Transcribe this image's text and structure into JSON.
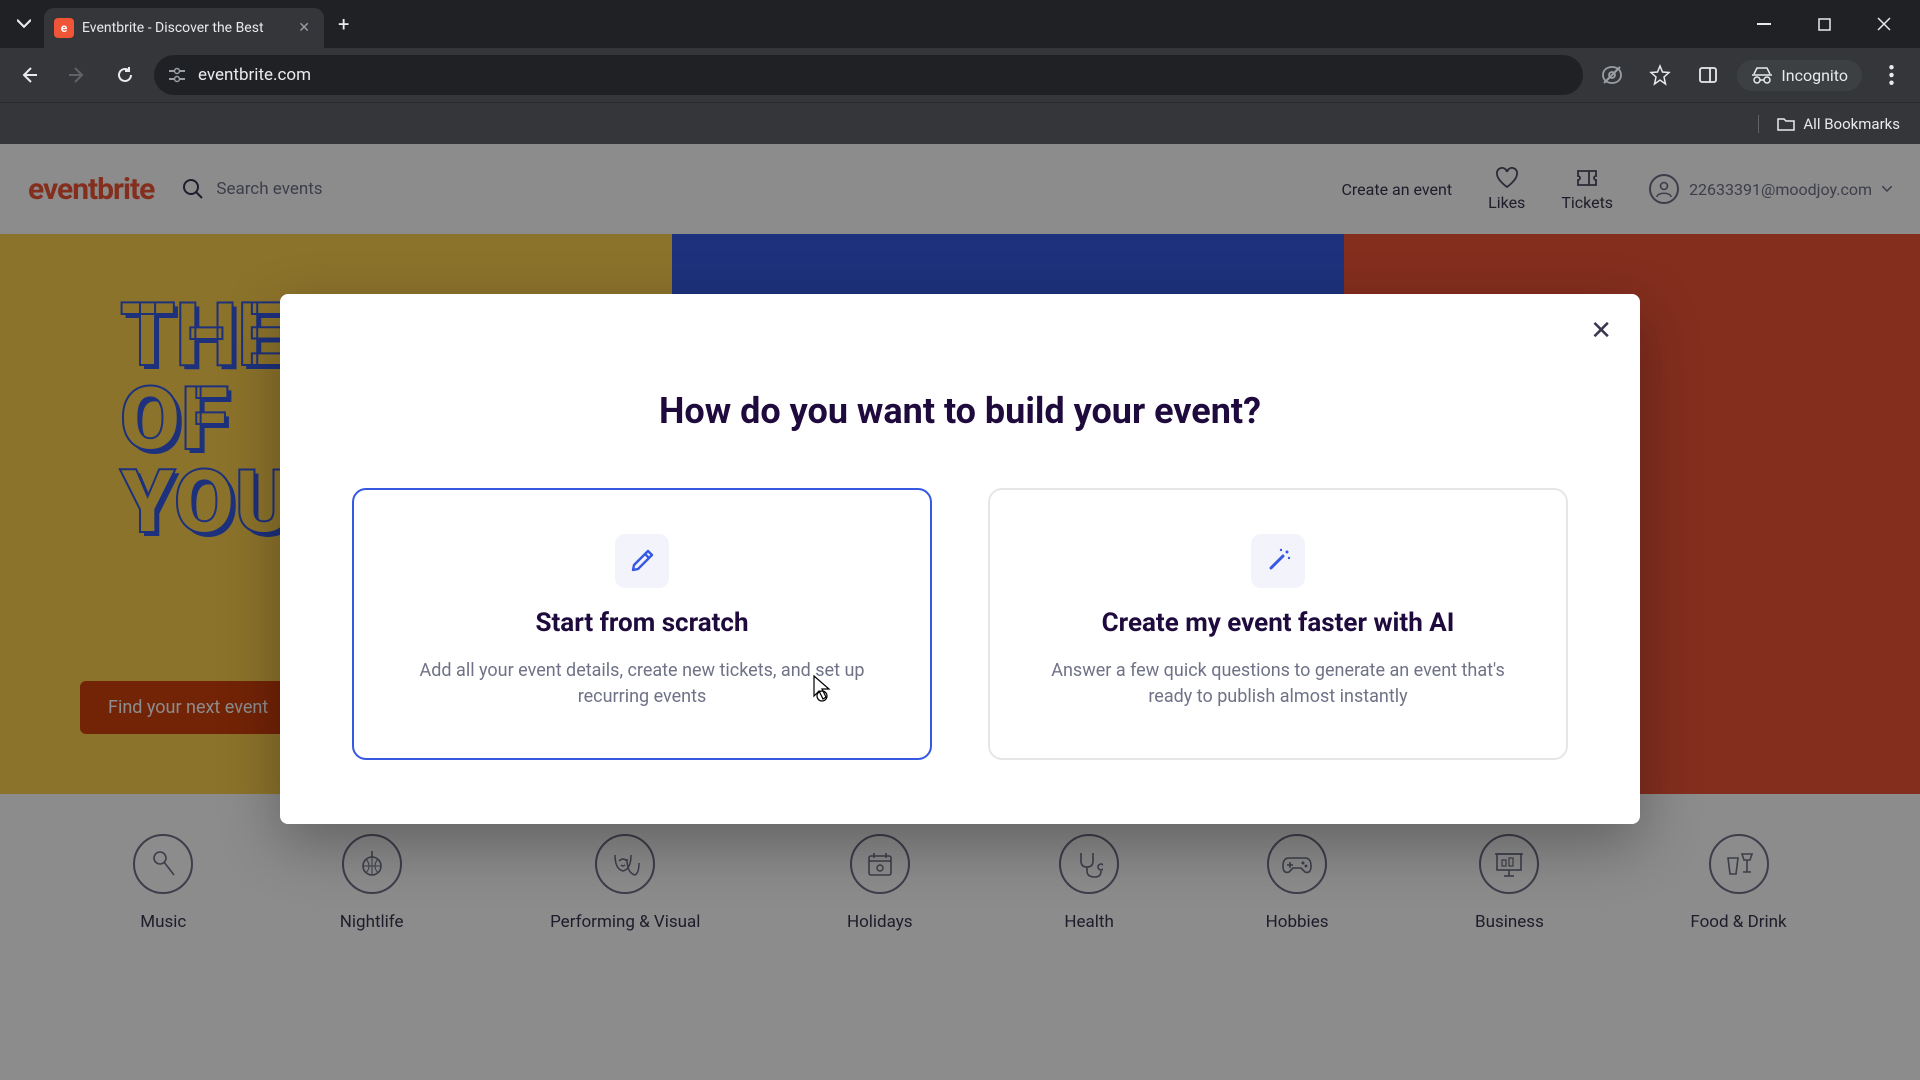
{
  "browser": {
    "tab_title": "Eventbrite - Discover the Best",
    "url": "eventbrite.com",
    "incognito_label": "Incognito",
    "all_bookmarks": "All Bookmarks"
  },
  "header": {
    "logo": "eventbrite",
    "search_placeholder": "Search events",
    "create_event": "Create an event",
    "likes": "Likes",
    "tickets": "Tickets",
    "user_email": "22633391@moodjoy.com"
  },
  "hero": {
    "line1": "THE",
    "line2": "OF",
    "line3": "YOU",
    "cta": "Find your next event"
  },
  "categories": [
    {
      "label": "Music"
    },
    {
      "label": "Nightlife"
    },
    {
      "label": "Performing & Visual"
    },
    {
      "label": "Holidays"
    },
    {
      "label": "Health"
    },
    {
      "label": "Hobbies"
    },
    {
      "label": "Business"
    },
    {
      "label": "Food & Drink"
    }
  ],
  "modal": {
    "title": "How do you want to build your event?",
    "option1": {
      "title": "Start from scratch",
      "desc": "Add all your event details, create new tickets, and set up recurring events"
    },
    "option2": {
      "title": "Create my event faster with AI",
      "desc": "Answer a few quick questions to generate an event that's ready to publish almost instantly"
    }
  }
}
